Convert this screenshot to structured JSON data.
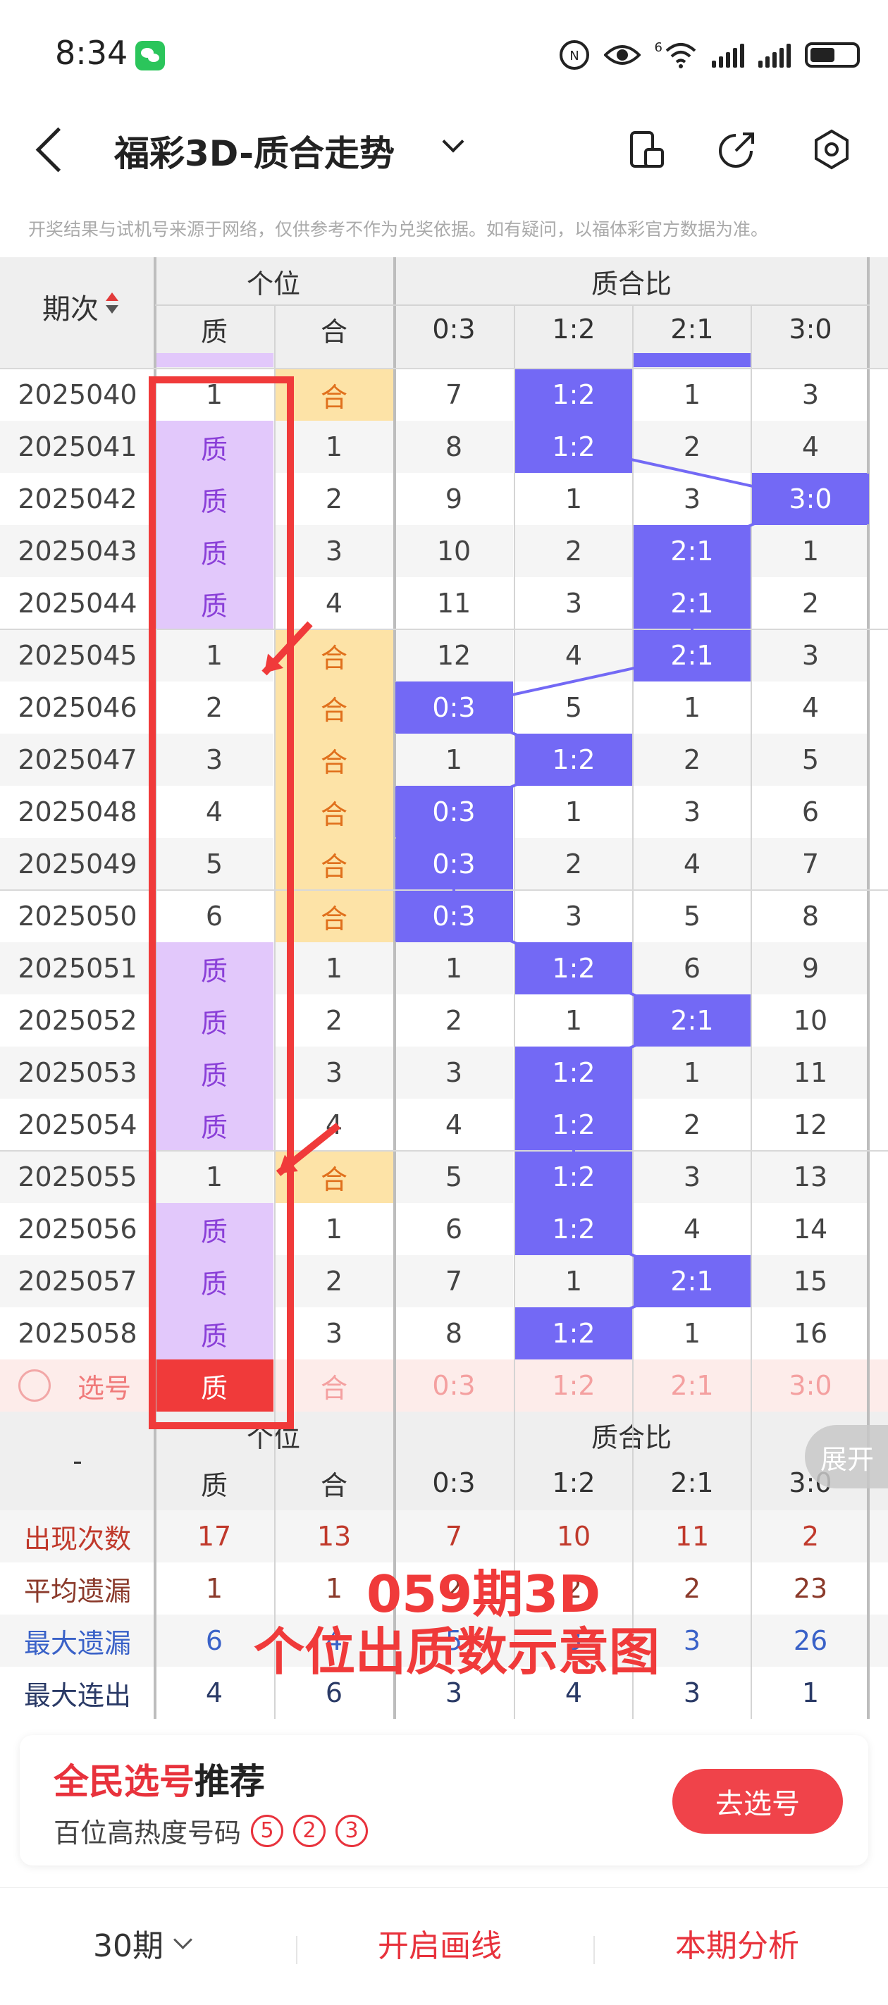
{
  "status": {
    "time": "8:34",
    "net_label": "6"
  },
  "nav": {
    "title": "福彩3D-质合走势",
    "icons": [
      "back-icon",
      "chevron-down-icon",
      "phone-orientation-icon",
      "share-icon",
      "settings-icon"
    ]
  },
  "disclaimer": "开奖结果与试机号来源于网络，仅供参考不作为兑奖依据。如有疑问，以福体彩官方数据为准。",
  "table": {
    "period_header": "期次",
    "group1_header": "个位",
    "group2_header": "质合比",
    "sub_headers": [
      "质",
      "合",
      "0:3",
      "1:2",
      "2:1",
      "3:0"
    ],
    "rows": [
      {
        "period": "2025040",
        "cells": [
          "1",
          "合",
          "7",
          "1:2",
          "1",
          "3"
        ],
        "hl": [
          1,
          3
        ]
      },
      {
        "period": "2025041",
        "cells": [
          "质",
          "1",
          "8",
          "1:2",
          "2",
          "4"
        ],
        "hl": [
          0,
          3
        ]
      },
      {
        "period": "2025042",
        "cells": [
          "质",
          "2",
          "9",
          "1",
          "3",
          "3:0"
        ],
        "hl": [
          0,
          5
        ]
      },
      {
        "period": "2025043",
        "cells": [
          "质",
          "3",
          "10",
          "2",
          "2:1",
          "1"
        ],
        "hl": [
          0,
          4
        ]
      },
      {
        "period": "2025044",
        "cells": [
          "质",
          "4",
          "11",
          "3",
          "2:1",
          "2"
        ],
        "hl": [
          0,
          4
        ]
      },
      {
        "period": "2025045",
        "cells": [
          "1",
          "合",
          "12",
          "4",
          "2:1",
          "3"
        ],
        "hl": [
          1,
          4
        ]
      },
      {
        "period": "2025046",
        "cells": [
          "2",
          "合",
          "0:3",
          "5",
          "1",
          "4"
        ],
        "hl": [
          1,
          2
        ]
      },
      {
        "period": "2025047",
        "cells": [
          "3",
          "合",
          "1",
          "1:2",
          "2",
          "5"
        ],
        "hl": [
          1,
          3
        ]
      },
      {
        "period": "2025048",
        "cells": [
          "4",
          "合",
          "0:3",
          "1",
          "3",
          "6"
        ],
        "hl": [
          1,
          2
        ]
      },
      {
        "period": "2025049",
        "cells": [
          "5",
          "合",
          "0:3",
          "2",
          "4",
          "7"
        ],
        "hl": [
          1,
          2
        ]
      },
      {
        "period": "2025050",
        "cells": [
          "6",
          "合",
          "0:3",
          "3",
          "5",
          "8"
        ],
        "hl": [
          1,
          2
        ]
      },
      {
        "period": "2025051",
        "cells": [
          "质",
          "1",
          "1",
          "1:2",
          "6",
          "9"
        ],
        "hl": [
          0,
          3
        ]
      },
      {
        "period": "2025052",
        "cells": [
          "质",
          "2",
          "2",
          "1",
          "2:1",
          "10"
        ],
        "hl": [
          0,
          4
        ]
      },
      {
        "period": "2025053",
        "cells": [
          "质",
          "3",
          "3",
          "1:2",
          "1",
          "11"
        ],
        "hl": [
          0,
          3
        ]
      },
      {
        "period": "2025054",
        "cells": [
          "质",
          "4",
          "4",
          "1:2",
          "2",
          "12"
        ],
        "hl": [
          0,
          3
        ]
      },
      {
        "period": "2025055",
        "cells": [
          "1",
          "合",
          "5",
          "1:2",
          "3",
          "13"
        ],
        "hl": [
          1,
          3
        ]
      },
      {
        "period": "2025056",
        "cells": [
          "质",
          "1",
          "6",
          "1:2",
          "4",
          "14"
        ],
        "hl": [
          0,
          3
        ]
      },
      {
        "period": "2025057",
        "cells": [
          "质",
          "2",
          "7",
          "1",
          "2:1",
          "15"
        ],
        "hl": [
          0,
          4
        ]
      },
      {
        "period": "2025058",
        "cells": [
          "质",
          "3",
          "8",
          "1:2",
          "1",
          "16"
        ],
        "hl": [
          0,
          3
        ]
      }
    ],
    "select_row": {
      "label": "选号",
      "cells": [
        "质",
        "合",
        "0:3",
        "1:2",
        "2:1",
        "3:0"
      ]
    },
    "footer_period": "-",
    "stats": [
      {
        "label": "出现次数",
        "values": [
          "17",
          "13",
          "7",
          "10",
          "11",
          "2"
        ],
        "color": "#c0392b"
      },
      {
        "label": "平均遗漏",
        "values": [
          "1",
          "1",
          "2",
          "2",
          "2",
          "23"
        ],
        "color": "#8b3a2b"
      },
      {
        "label": "最大遗漏",
        "values": [
          "6",
          "4",
          "5",
          "3",
          "3",
          "26"
        ],
        "color": "#3a62c8"
      },
      {
        "label": "最大连出",
        "values": [
          "4",
          "6",
          "3",
          "4",
          "3",
          "1"
        ],
        "color": "#2a3a66"
      }
    ]
  },
  "annotation": {
    "line1": "059期3D",
    "line2": "个位出质数示意图"
  },
  "expand_label": "展开",
  "recommend": {
    "title_red": "全民选号",
    "title_black": "推荐",
    "subtitle": "百位高热度号码",
    "balls": [
      "5",
      "2",
      "3"
    ],
    "button": "去选号"
  },
  "tabs": {
    "periods": "30期",
    "draw": "开启画线",
    "analysis": "本期分析"
  },
  "colors": {
    "purple": "#e2c8fb",
    "orange": "#fde3a7",
    "blue": "#7369f5",
    "red": "#f03a3a",
    "select_bg": "#fdecea"
  }
}
